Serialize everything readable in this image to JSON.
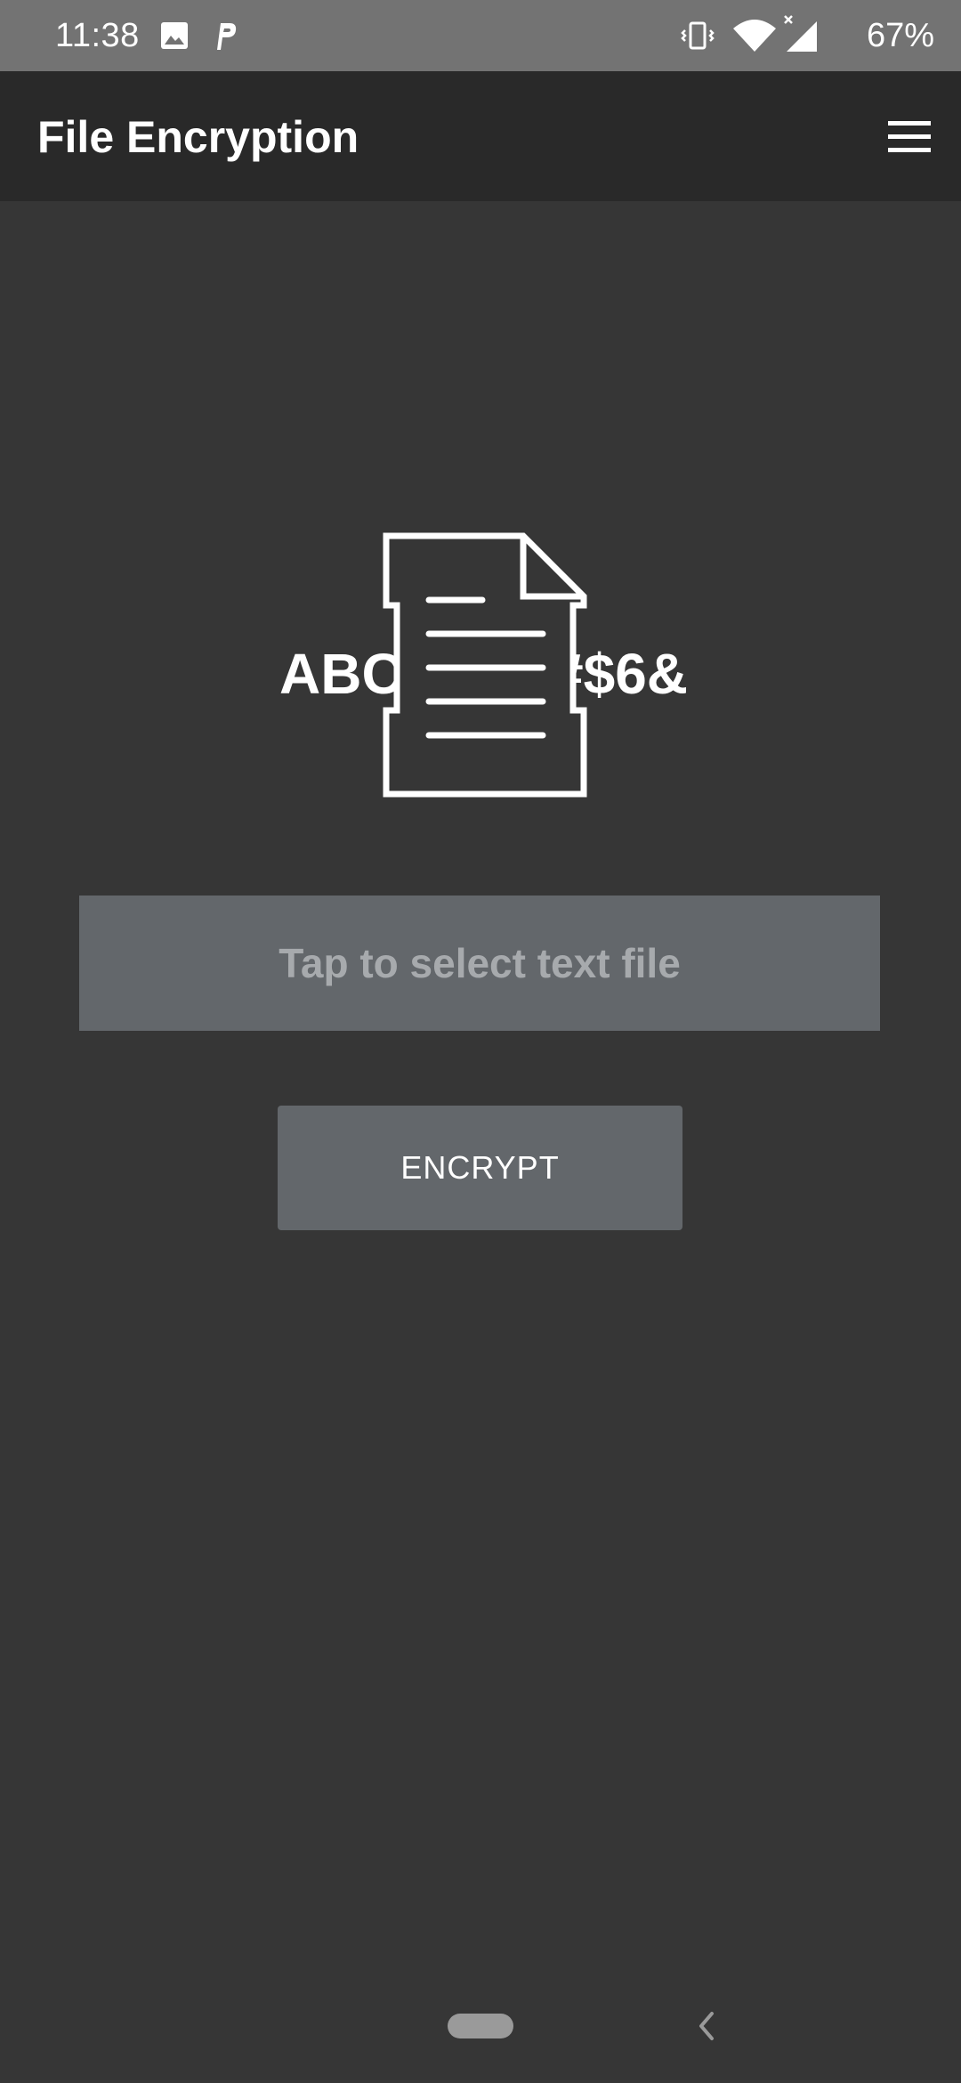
{
  "status_bar": {
    "time": "11:38",
    "battery": "67%",
    "icons": [
      "image-icon",
      "p-app-icon",
      "vibrate-icon",
      "wifi-icon",
      "signal-icon"
    ]
  },
  "app_bar": {
    "title": "File Encryption",
    "menu_icon": "hamburger-menu-icon"
  },
  "illustration": {
    "plain_text": "ABCD",
    "cipher_text": "#$6&",
    "icon": "document-icon"
  },
  "file_select": {
    "label": "Tap to select text file"
  },
  "actions": {
    "encrypt_label": "ENCRYPT"
  },
  "nav_bar": {
    "home_icon": "home-pill-icon",
    "back_icon": "back-chevron-icon"
  },
  "colors": {
    "background": "#363636",
    "app_bar": "#292929",
    "status_bar": "#737373",
    "control": "#63676b",
    "placeholder_text": "#a7aaad"
  }
}
